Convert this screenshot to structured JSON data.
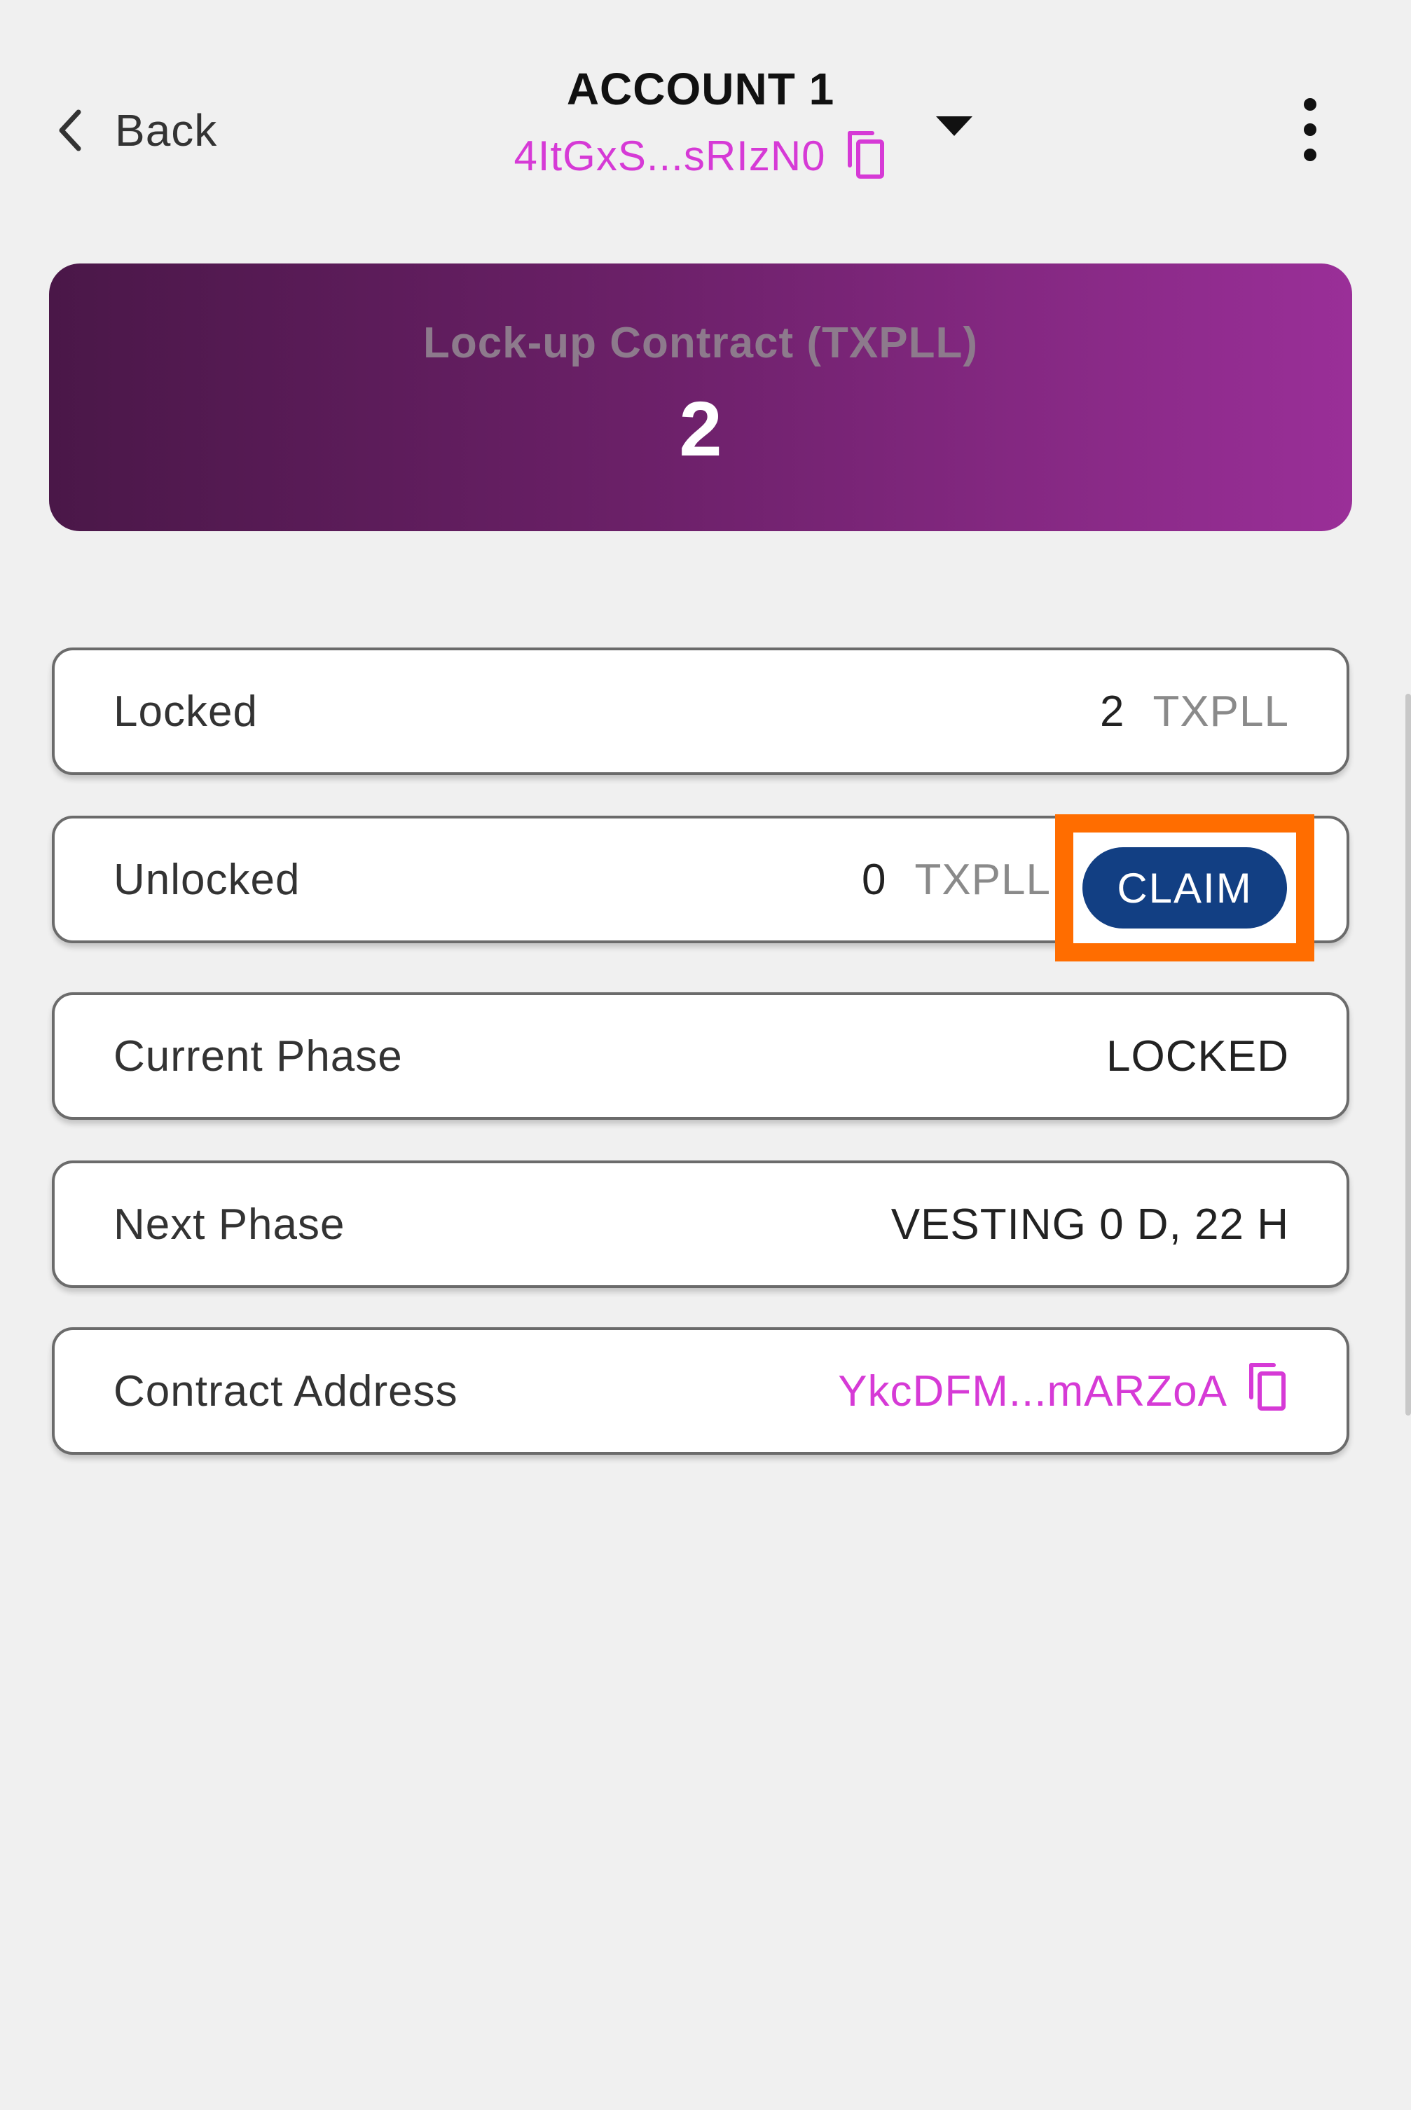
{
  "header": {
    "back_label": "Back",
    "account_name": "ACCOUNT 1",
    "account_address": "4ItGxS...sRIzN0"
  },
  "banner": {
    "title": "Lock-up Contract (TXPLL)",
    "value": "2"
  },
  "rows": {
    "locked": {
      "label": "Locked",
      "amount": "2",
      "unit": "TXPLL"
    },
    "unlocked": {
      "label": "Unlocked",
      "amount": "0",
      "unit": "TXPLL",
      "button_label": "CLAIM"
    },
    "current_phase": {
      "label": "Current Phase",
      "value": "LOCKED"
    },
    "next_phase": {
      "label": "Next Phase",
      "value": "VESTING 0 D, 22 H"
    },
    "contract_address": {
      "label": "Contract Address",
      "value": "YkcDFM...mARZoA"
    }
  },
  "icons": {
    "back": "chevron-left-icon",
    "copy": "copy-icon",
    "dropdown": "caret-down-icon",
    "menu": "kebab-menu-icon"
  },
  "colors": {
    "accent_magenta": "#d63ad6",
    "claim_button": "#123f83",
    "highlight": "#ff6d00",
    "banner_start": "#4a1748",
    "banner_end": "#9a2f98"
  }
}
